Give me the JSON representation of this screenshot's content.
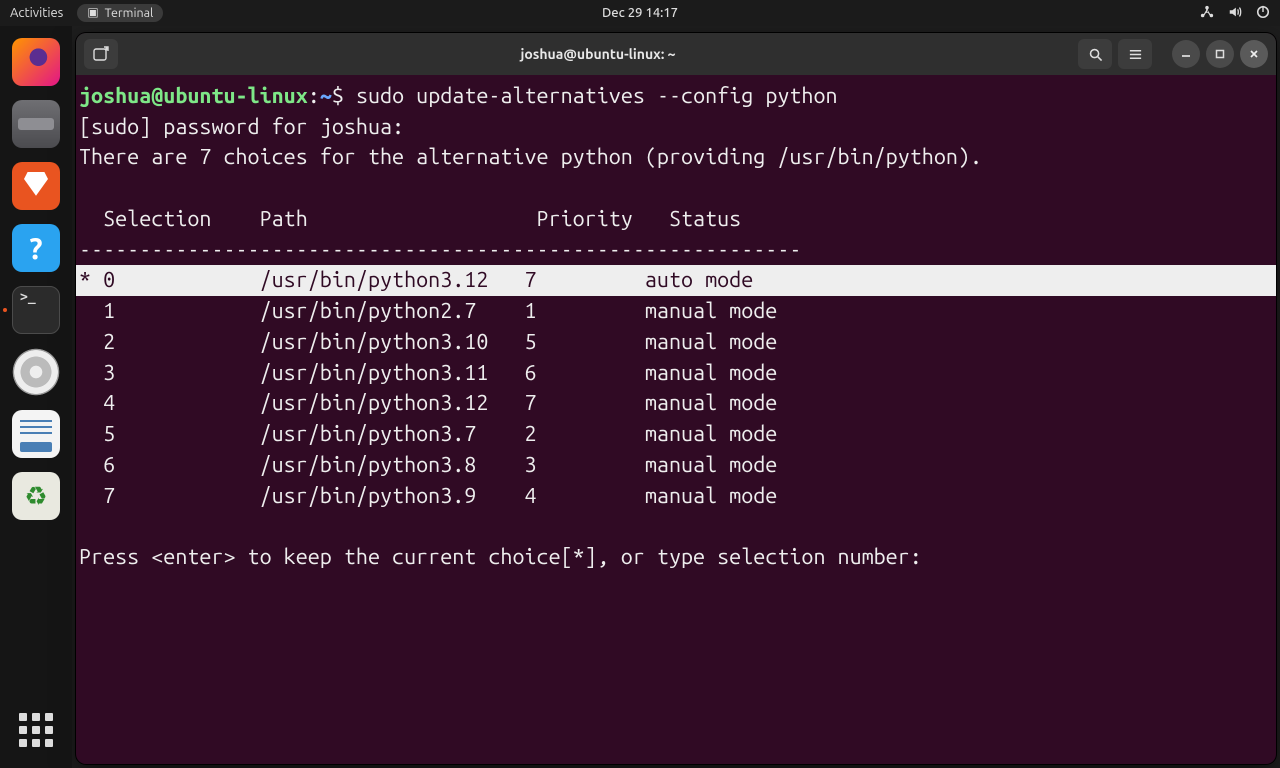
{
  "topbar": {
    "activities": "Activities",
    "app_indicator": "Terminal",
    "clock": "Dec 29  14:17"
  },
  "dock": {
    "items": [
      {
        "name": "firefox"
      },
      {
        "name": "files"
      },
      {
        "name": "software"
      },
      {
        "name": "help"
      },
      {
        "name": "terminal",
        "active": true
      },
      {
        "name": "disks"
      },
      {
        "name": "text-editor"
      },
      {
        "name": "trash"
      }
    ]
  },
  "window": {
    "title": "joshua@ubuntu-linux: ~"
  },
  "terminal": {
    "prompt": {
      "userhost": "joshua@ubuntu-linux",
      "sep": ":",
      "path": "~",
      "dollar": "$ "
    },
    "command": "sudo update-alternatives --config python",
    "sudo_line": "[sudo] password for joshua:",
    "intro_line": "There are 7 choices for the alternative python (providing /usr/bin/python).",
    "header": "  Selection    Path                   Priority   Status",
    "divider": "------------------------------------------------------------",
    "rows": [
      {
        "text": "* 0            /usr/bin/python3.12   7         auto mode",
        "selected": true
      },
      {
        "text": "  1            /usr/bin/python2.7    1         manual mode",
        "selected": false
      },
      {
        "text": "  2            /usr/bin/python3.10   5         manual mode",
        "selected": false
      },
      {
        "text": "  3            /usr/bin/python3.11   6         manual mode",
        "selected": false
      },
      {
        "text": "  4            /usr/bin/python3.12   7         manual mode",
        "selected": false
      },
      {
        "text": "  5            /usr/bin/python3.7    2         manual mode",
        "selected": false
      },
      {
        "text": "  6            /usr/bin/python3.8    3         manual mode",
        "selected": false
      },
      {
        "text": "  7            /usr/bin/python3.9    4         manual mode",
        "selected": false
      }
    ],
    "footer": "Press <enter> to keep the current choice[*], or type selection number:"
  }
}
